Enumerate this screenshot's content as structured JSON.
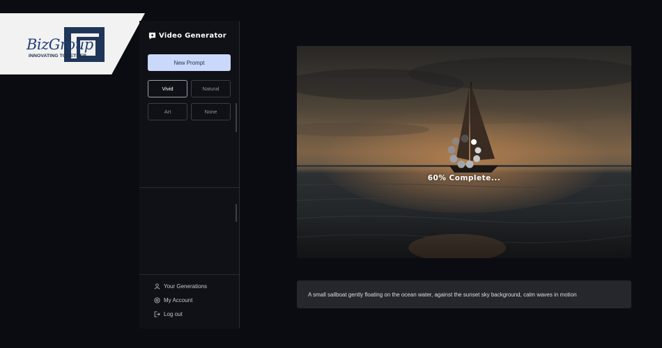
{
  "logo": {
    "name_part1": "Biz",
    "name_part2": "Group",
    "tagline": "INNOVATING TOGETHER"
  },
  "sidebar": {
    "title": "Video Generator",
    "new_prompt_label": "New Prompt",
    "styles": [
      {
        "label": "Vivid",
        "active": true
      },
      {
        "label": "Natural",
        "active": false
      },
      {
        "label": "Art",
        "active": false
      },
      {
        "label": "None",
        "active": false
      }
    ],
    "menu": [
      {
        "label": "Your Generations",
        "icon": "user-icon"
      },
      {
        "label": "My Account",
        "icon": "settings-icon"
      },
      {
        "label": "Log out",
        "icon": "logout-icon"
      }
    ]
  },
  "video": {
    "progress_percent": 60,
    "progress_label": "60% Complete..."
  },
  "prompt": {
    "text": "A small sailboat gently floating on the ocean water, against the sunset sky background, calm waves in motion"
  },
  "colors": {
    "background": "#0b0c11",
    "sidebar": "#101116",
    "accent_button": "#c9d8fb",
    "logo_navy": "#1f3f78",
    "logo_blue": "#2a7de1"
  }
}
